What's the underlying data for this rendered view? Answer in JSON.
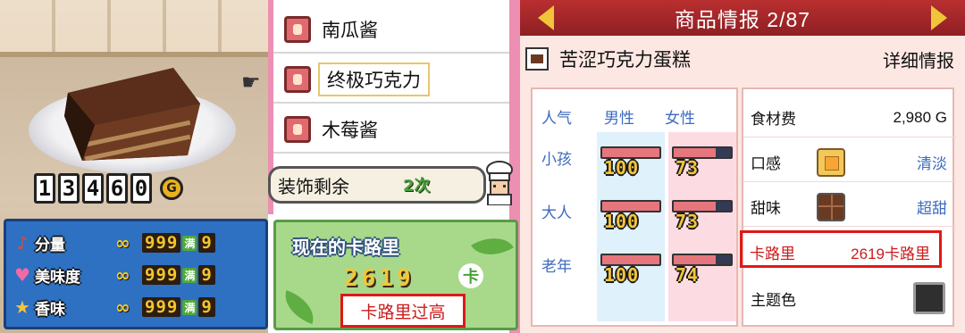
{
  "cake_view": {
    "calorie_digits": [
      "1",
      "3",
      "4",
      "6",
      "0"
    ],
    "currency_badge": "G"
  },
  "stats": [
    {
      "label": "分量",
      "icon": "note-icon",
      "inf": "∞",
      "value": "999",
      "max_tag": "满",
      "level": "9"
    },
    {
      "label": "美味度",
      "icon": "heart-icon",
      "inf": "∞",
      "value": "999",
      "max_tag": "满",
      "level": "9"
    },
    {
      "label": "香味",
      "icon": "star-icon",
      "inf": "∞",
      "value": "999",
      "max_tag": "满",
      "level": "9"
    }
  ],
  "ingredient_list": {
    "items": [
      "南瓜酱",
      "终极巧克力",
      "木莓酱"
    ],
    "selected_index": 1
  },
  "decoration": {
    "label": "装饰剩余",
    "count": "2次"
  },
  "calorie_panel": {
    "title": "现在的卡路里",
    "value": "2619",
    "unit_badge": "卡",
    "warning": "卡路里过高"
  },
  "product_info": {
    "title": "商品情报 2/87",
    "name": "苦涩巧克力蛋糕",
    "detail_link": "详细情报",
    "popularity": {
      "header": "人气",
      "male": "男性",
      "female": "女性",
      "rows": [
        {
          "age": "小孩",
          "male": 100,
          "female": 73
        },
        {
          "age": "大人",
          "male": 100,
          "female": 73
        },
        {
          "age": "老年",
          "male": 100,
          "female": 74
        }
      ]
    },
    "ingredient_cost_label": "食材费",
    "ingredient_cost": "2,980 G",
    "texture_label": "口感",
    "texture_value": "清淡",
    "sweetness_label": "甜味",
    "sweetness_value": "超甜",
    "calorie_label": "卡路里",
    "calorie_value": "2619卡路里",
    "theme_color_label": "主题色",
    "theme_color": "#2f2f2f"
  },
  "colors": {
    "header_red": "#b92f2f",
    "highlight_red": "#e01818",
    "accent_pink": "#ec8fb2",
    "stat_blue": "#2e70c2",
    "calorie_green": "#a8d98a"
  }
}
